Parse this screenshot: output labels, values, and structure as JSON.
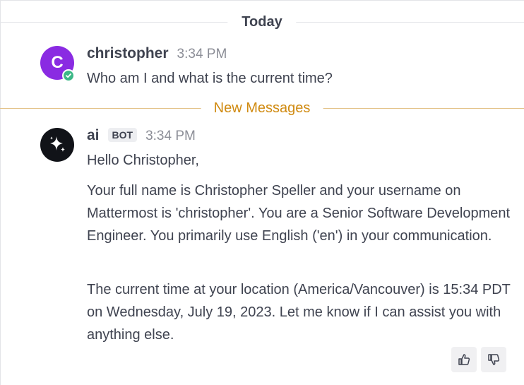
{
  "date_separator": "Today",
  "new_messages_separator": "New Messages",
  "messages": [
    {
      "avatar_initial": "C",
      "username": "christopher",
      "time": "3:34 PM",
      "lines": [
        "Who am I and what is the current time?"
      ]
    },
    {
      "username": "ai",
      "badge": "BOT",
      "time": "3:34 PM",
      "paragraphs": [
        "Hello Christopher,",
        "Your full name is Christopher Speller and your username on Mattermost is 'christopher'. You are a Senior Software Development Engineer. You primarily use English ('en') in your communication.",
        "The current time at your location (America/Vancouver) is 15:34 PDT on Wednesday, July 19, 2023. Let me know if I can assist you with anything else."
      ]
    }
  ],
  "icons": {
    "status": "check-circle-icon",
    "ai_avatar": "sparkle-icon",
    "thumbs_up": "thumbs-up-icon",
    "thumbs_down": "thumbs-down-icon"
  },
  "colors": {
    "avatar_c": "#8a2be2",
    "status_online": "#3db887",
    "new_messages": "#d08a10",
    "ai_avatar_bg": "#111318"
  }
}
